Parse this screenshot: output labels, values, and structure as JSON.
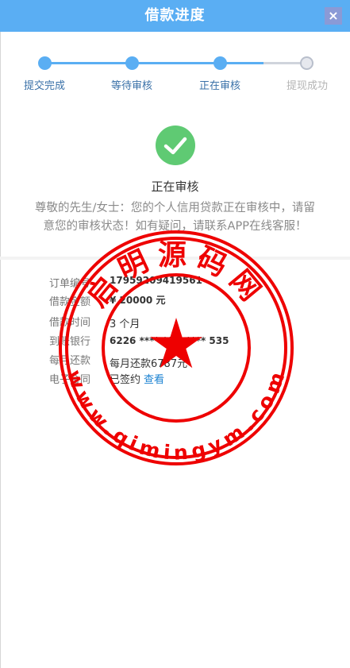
{
  "header": {
    "title": "借款进度",
    "close_label": "×"
  },
  "steps": [
    {
      "label": "提交完成",
      "state": "done"
    },
    {
      "label": "等待审核",
      "state": "done"
    },
    {
      "label": "正在审核",
      "state": "done"
    },
    {
      "label": "提现成功",
      "state": "todo"
    }
  ],
  "status": {
    "icon": "check-circle-icon",
    "title": "正在审核",
    "message": "尊敬的先生/女士：您的个人信用贷款正在审核中，请留意您的审核状态！如有疑问，请联系APP在线客服！"
  },
  "details": {
    "order_no": {
      "label": "订单编号",
      "value": "17959209419561"
    },
    "amount": {
      "label": "借款金额",
      "value": "¥ 20000 元"
    },
    "term": {
      "label": "借款时间",
      "value": "3 个月"
    },
    "bank": {
      "label": "到账银行",
      "value": "6226 **** **** **** 535"
    },
    "monthly": {
      "label": "每月还款",
      "value": "每月还款6787元"
    },
    "contract": {
      "label": "电子合同",
      "value": "已签约",
      "link": "查看"
    }
  },
  "stamp": {
    "top_text": "启明源码网",
    "bottom_text": "www.qimingym.com",
    "color": "#ee0000"
  },
  "colors": {
    "accent": "#5aaef3",
    "success": "#5fca73",
    "link": "#1b82d2"
  }
}
